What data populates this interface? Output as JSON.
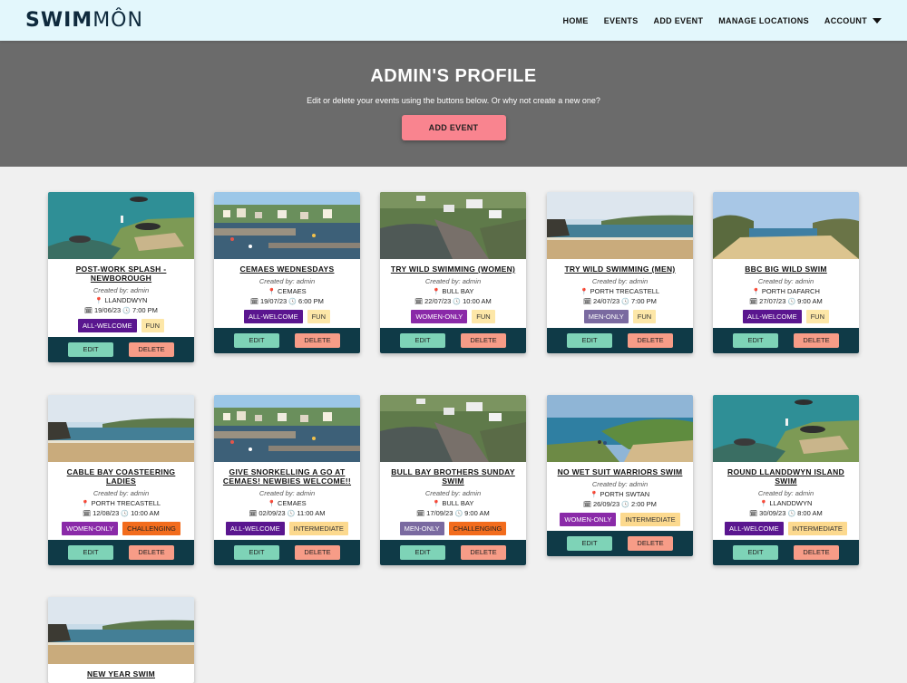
{
  "brand": {
    "bold": "SWIM",
    "light": "MÔN"
  },
  "nav": {
    "home": "HOME",
    "events": "EVENTS",
    "add_event": "ADD EVENT",
    "manage_locations": "MANAGE LOCATIONS",
    "account": "ACCOUNT"
  },
  "hero": {
    "title": "ADMIN'S PROFILE",
    "subtitle": "Edit or delete your events using the buttons below. Or why not create a new one?",
    "button": "ADD EVENT"
  },
  "labels": {
    "edit": "EDIT",
    "delete": "DELETE"
  },
  "colors": {
    "navbar_bg": "#e3f7fc",
    "hero_bg": "#6b6b6b",
    "accent_pink": "#f9848f",
    "card_footer": "#0f3a47",
    "edit_btn": "#7ed3b7",
    "delete_btn": "#f79c87",
    "all_welcome": "#5a168f",
    "women_only": "#8a2aa8",
    "men_only": "#7a6aa0",
    "fun": "#fde7a8",
    "challenging": "#f26c1d",
    "intermediate": "#fcd98e"
  },
  "cards": [
    {
      "title": "POST-WORK SPLASH - NEWBOROUGH",
      "created_by": "Created by: admin",
      "location": "LLANDDWYN",
      "date": "19/06/23",
      "time": "7:00 PM",
      "tags": [
        "ALL-WELCOME",
        "FUN"
      ],
      "image": "coast-aerial"
    },
    {
      "title": "CEMAES WEDNESDAYS",
      "created_by": "Created by: admin",
      "location": "CEMAES",
      "date": "19/07/23",
      "time": "6:00 PM",
      "tags": [
        "ALL-WELCOME",
        "FUN"
      ],
      "image": "harbour"
    },
    {
      "title": "TRY WILD SWIMMING (WOMEN)",
      "created_by": "Created by: admin",
      "location": "BULL BAY",
      "date": "22/07/23",
      "time": "10:00 AM",
      "tags": [
        "WOMEN-ONLY",
        "FUN"
      ],
      "image": "bay-village"
    },
    {
      "title": "TRY WILD SWIMMING (MEN)",
      "created_by": "Created by: admin",
      "location": "PORTH TRECASTELL",
      "date": "24/07/23",
      "time": "7:00 PM",
      "tags": [
        "MEN-ONLY",
        "FUN"
      ],
      "image": "beach"
    },
    {
      "title": "BBC BIG WILD SWIM",
      "created_by": "Created by: admin",
      "location": "PORTH DAFARCH",
      "date": "27/07/23",
      "time": "9:00 AM",
      "tags": [
        "ALL-WELCOME",
        "FUN"
      ],
      "image": "cove"
    },
    {
      "title": "CABLE BAY COASTEERING LADIES",
      "created_by": "Created by: admin",
      "location": "PORTH TRECASTELL",
      "date": "12/08/23",
      "time": "10:00 AM",
      "tags": [
        "WOMEN-ONLY",
        "CHALLENGING"
      ],
      "image": "beach"
    },
    {
      "title": "GIVE SNORKELLING A GO AT CEMAES! NEWBIES WELCOME!!",
      "created_by": "Created by: admin",
      "location": "CEMAES",
      "date": "02/09/23",
      "time": "11:00 AM",
      "tags": [
        "ALL-WELCOME",
        "INTERMEDIATE"
      ],
      "image": "harbour"
    },
    {
      "title": "BULL BAY BROTHERS SUNDAY SWIM",
      "created_by": "Created by: admin",
      "location": "BULL BAY",
      "date": "17/09/23",
      "time": "9:00 AM",
      "tags": [
        "MEN-ONLY",
        "CHALLENGING"
      ],
      "image": "bay-village"
    },
    {
      "title": "NO WET SUIT WARRIORS SWIM",
      "created_by": "Created by: admin",
      "location": "PORTH SWTAN",
      "date": "26/09/23",
      "time": "2:00 PM",
      "tags": [
        "WOMEN-ONLY",
        "INTERMEDIATE"
      ],
      "image": "cliff-beach"
    },
    {
      "title": "ROUND LLANDDWYN ISLAND SWIM",
      "created_by": "Created by: admin",
      "location": "LLANDDWYN",
      "date": "30/09/23",
      "time": "8:00 AM",
      "tags": [
        "ALL-WELCOME",
        "INTERMEDIATE"
      ],
      "image": "coast-aerial"
    },
    {
      "title": "NEW YEAR SWIM",
      "created_by": "",
      "location": "",
      "date": "",
      "time": "",
      "tags": [],
      "image": "beach"
    }
  ]
}
